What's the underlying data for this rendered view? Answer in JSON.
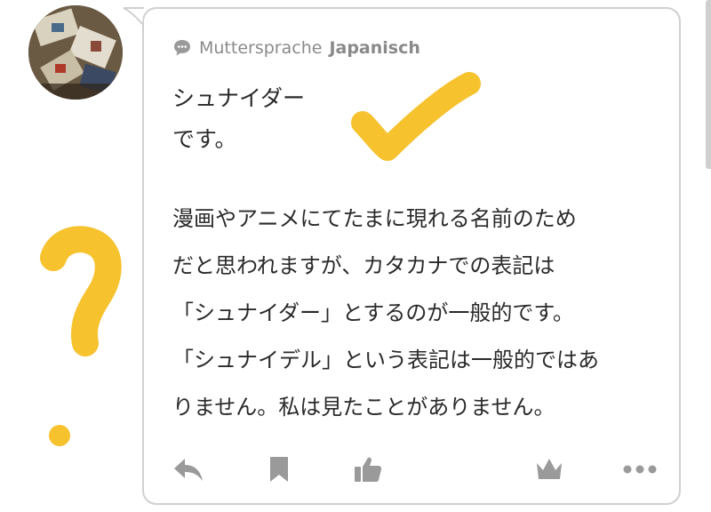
{
  "header": {
    "label": "Muttersprache",
    "language": "Japanisch"
  },
  "answer": {
    "word": "シュナイダー\nです。",
    "text": "漫画やアニメにてたまに現れる名前のため\nだと思われますが、カタカナでの表記は\n「シュナイダー」とするのが一般的です。\n「シュナイデル」という表記は一般的ではあ\nりません。私は見たことがありません。"
  },
  "icons": {
    "speech": "speech-bubble-icon",
    "reply": "reply-icon",
    "bookmark": "bookmark-icon",
    "like": "thumbs-up-icon",
    "crown": "crown-icon",
    "more": "more-dots-icon"
  },
  "colors": {
    "annotation": "#F6C22E",
    "icon_gray": "#9a9a9a",
    "border": "#d0d0d0"
  }
}
